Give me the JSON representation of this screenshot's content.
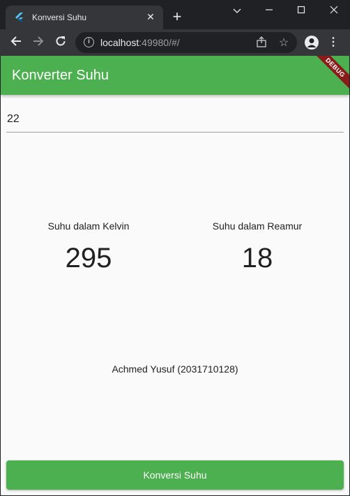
{
  "browser": {
    "tab_title": "Konversi Suhu",
    "url_host": "localhost",
    "url_rest": ":49980/#/"
  },
  "app": {
    "title": "Konverter Suhu",
    "debug_label": "DEBUG",
    "input_value": "22",
    "kelvin": {
      "label": "Suhu dalam Kelvin",
      "value": "295"
    },
    "reamur": {
      "label": "Suhu dalam Reamur",
      "value": "18"
    },
    "author": "Achmed Yusuf (2031710128)",
    "button_label": "Konversi Suhu"
  },
  "colors": {
    "primary": "#4caf50",
    "debug_banner": "#8b1a1a",
    "chrome_dark": "#202124",
    "chrome_toolbar": "#35363a"
  },
  "icons": {
    "favicon": "flutter-icon",
    "close": "close-icon",
    "new_tab": "plus-icon",
    "back": "back-arrow-icon",
    "forward": "forward-arrow-icon",
    "reload": "reload-icon",
    "info": "info-icon",
    "share": "share-icon",
    "bookmark": "star-icon",
    "profile": "avatar-icon",
    "menu": "kebab-menu-icon"
  }
}
